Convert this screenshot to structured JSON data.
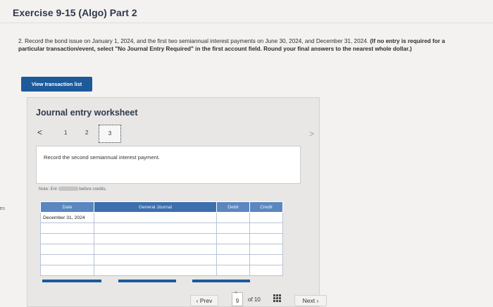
{
  "header": {
    "title": "Exercise 9-15 (Algo) Part 2"
  },
  "left_edge_text": "ces",
  "instructions": {
    "text_regular": "2. Record the bond issue on January 1, 2024, and the first two semiannual interest payments on June 30, 2024, and December 31, 2024. ",
    "text_bold": "(If no entry is required for a particular transaction/event, select \"No Journal Entry Required\" in the first account field. Round your final answers to the nearest whole dollar.)"
  },
  "view_button": {
    "label": "View transaction list"
  },
  "worksheet": {
    "title": "Journal entry worksheet",
    "pager": {
      "prev": "<",
      "pages": [
        "1",
        "2",
        "3"
      ],
      "active": "3",
      "next": ">"
    },
    "record_text": "Record the second semiannual interest payment.",
    "note_prefix": "Note: Ent",
    "note_suffix": "before credits.",
    "table": {
      "headers": {
        "date": "Date",
        "account": "General Journal",
        "debit": "Debit",
        "credit": "Credit"
      },
      "rows": [
        {
          "date": "December 31, 2024",
          "account": "",
          "debit": "",
          "credit": ""
        },
        {
          "date": "",
          "account": "",
          "debit": "",
          "credit": ""
        },
        {
          "date": "",
          "account": "",
          "debit": "",
          "credit": ""
        },
        {
          "date": "",
          "account": "",
          "debit": "",
          "credit": ""
        },
        {
          "date": "",
          "account": "",
          "debit": "",
          "credit": ""
        },
        {
          "date": "",
          "account": "",
          "debit": "",
          "credit": ""
        }
      ]
    }
  },
  "footer": {
    "prev_label": "Prev",
    "current_page": "9",
    "of_label": "of 10",
    "next_label": "Next"
  },
  "colors": {
    "accent": "#1d5a9a",
    "table_header": "#3d6fae",
    "background": "#f3f2f1"
  }
}
